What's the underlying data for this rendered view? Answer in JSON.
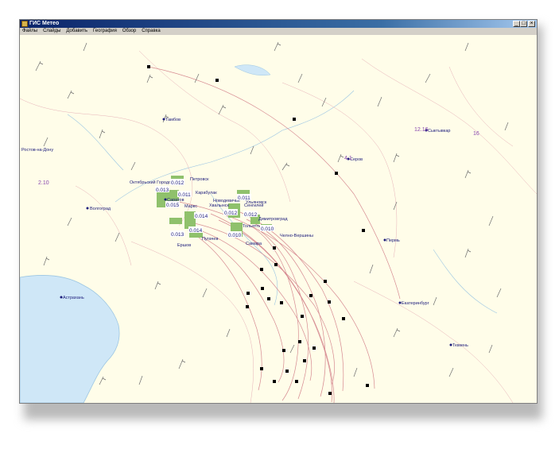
{
  "window": {
    "title": "ГИС Метео"
  },
  "menu": [
    "Файлы",
    "Слайды",
    "Добавить",
    "География",
    "Обзор",
    "Справка"
  ],
  "cities": [
    "Тамбов",
    "Ростов-на-Дону",
    "Волгоград",
    "Астрахань",
    "Октябрьский Городок",
    "Саратов",
    "Петровск",
    "Карабулак",
    "Маркс",
    "Хвалынск",
    "Новодевичье",
    "Ульяновск",
    "Сенгилей",
    "Димитровград",
    "Тольятти",
    "Челно-Вершины",
    "Самара",
    "Пугачев",
    "Ершов",
    "Сыктывкар",
    "Серов",
    "Пермь",
    "Екатеринбург",
    "Тюмень"
  ],
  "station_values": [
    "0.013",
    "0.012",
    "0.011",
    "0.015",
    "0.014",
    "0.013",
    "0.014",
    "0.011",
    "0.012",
    "0.012",
    "0.010",
    "0.010"
  ],
  "isolines": [
    "12.16",
    "16",
    "4.1",
    "2.10"
  ]
}
